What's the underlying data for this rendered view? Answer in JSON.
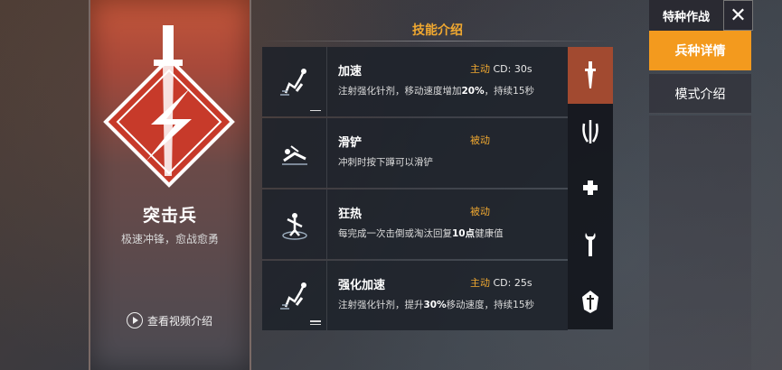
{
  "class": {
    "name": "突击兵",
    "motto": "极速冲锋，愈战愈勇",
    "video_link": "查看视频介绍"
  },
  "skills_panel": {
    "title": "技能介绍",
    "skills": [
      {
        "name": "加速",
        "type": "主动",
        "cd": "CD: 30s",
        "desc_pre": "注射强化针剂，移动速度增加",
        "desc_bold": "20%",
        "desc_post": "，持续15秒",
        "icon": "syringe-runner-icon",
        "level": 1
      },
      {
        "name": "滑铲",
        "type": "被动",
        "cd": "",
        "desc_pre": "冲刺时按下蹲可以滑铲",
        "desc_bold": "",
        "desc_post": "",
        "icon": "slide-icon",
        "level": 0
      },
      {
        "name": "狂热",
        "type": "被动",
        "cd": "",
        "desc_pre": "每完成一次击倒或淘汰回复",
        "desc_bold": "10点",
        "desc_post": "健康值",
        "icon": "fervor-icon",
        "level": 0
      },
      {
        "name": "强化加速",
        "type": "主动",
        "cd": "CD: 25s",
        "desc_pre": "注射强化针剂，提升",
        "desc_bold": "30%",
        "desc_post": "移动速度，持续15秒",
        "icon": "enhanced-syringe-icon",
        "level": 2
      }
    ]
  },
  "equip_column": {
    "slots": [
      "dagger-icon",
      "claw-icon",
      "plus-icon",
      "wrench-icon",
      "helmet-icon"
    ],
    "active_index": 0
  },
  "right_menu": {
    "title": "特种作战",
    "close_icon": "close-icon",
    "items": [
      {
        "label": "兵种详情",
        "active": true
      },
      {
        "label": "模式介绍",
        "active": false
      }
    ]
  },
  "colors": {
    "accent": "#f39a1e",
    "active_slot": "#a24a30",
    "skill_type": "#f0a830"
  }
}
